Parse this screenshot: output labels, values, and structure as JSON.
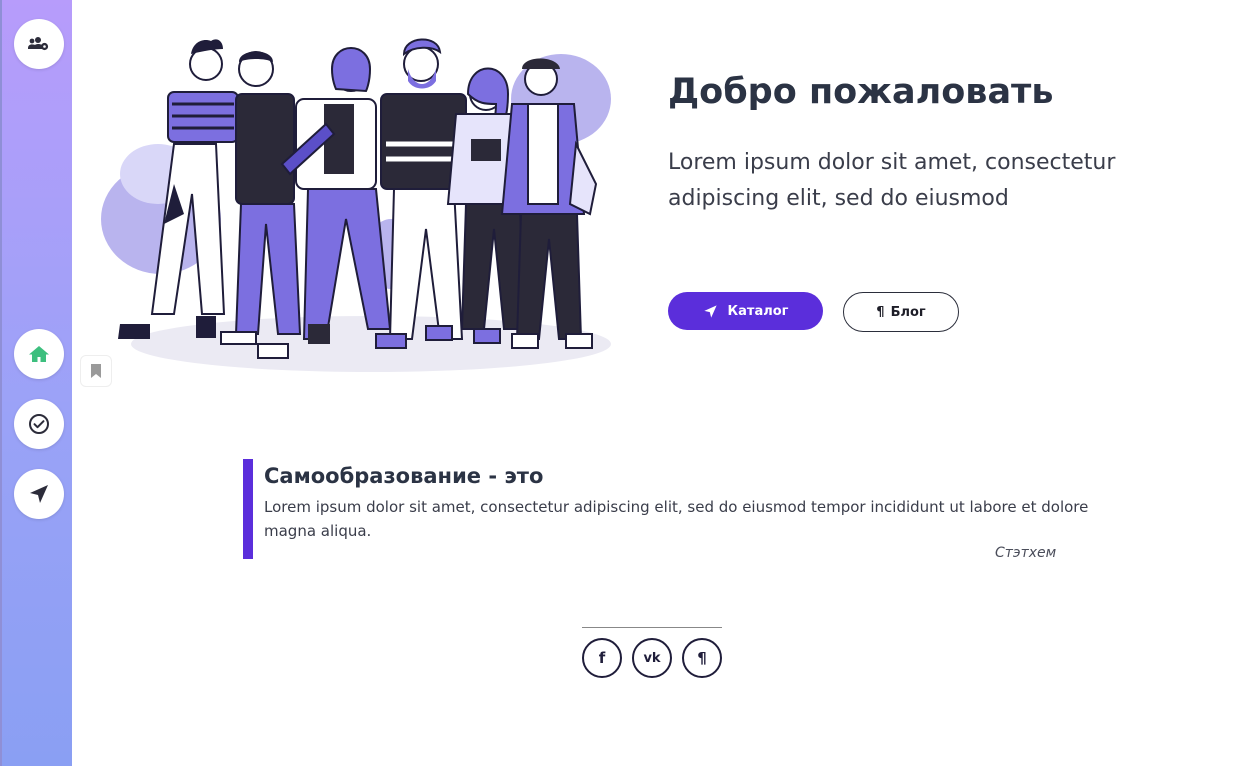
{
  "sidebar": {
    "items": [
      {
        "icon": "users-cog-icon",
        "name": "sidebar-users-settings"
      },
      {
        "icon": "home-icon",
        "name": "sidebar-item-home"
      },
      {
        "icon": "check-circle-icon",
        "name": "sidebar-item-tasks"
      },
      {
        "icon": "location-arrow-icon",
        "name": "sidebar-item-navigate"
      }
    ],
    "accent_home": "#3dbf7e"
  },
  "hero": {
    "title": "Добро пожаловать",
    "text": "Lorem ipsum dolor sit amet, consectetur adipiscing elit, sed do eiusmod",
    "catalog_button": "Каталог",
    "blog_button": "Блог",
    "blog_glyph": "¶"
  },
  "quote": {
    "title": "Самообразование - это",
    "text": "Lorem ipsum dolor sit amet, consectetur adipiscing elit, sed do eiusmod tempor incididunt ut labore et dolore magna aliqua.",
    "author": "Стэтхем"
  },
  "social": {
    "facebook": "f",
    "vk": "vk",
    "blog": "¶"
  },
  "colors": {
    "accent": "#5b2edb",
    "sidebar_top": "#b79cfb",
    "sidebar_bottom": "#8a9ff3",
    "dark": "#2b3344"
  }
}
